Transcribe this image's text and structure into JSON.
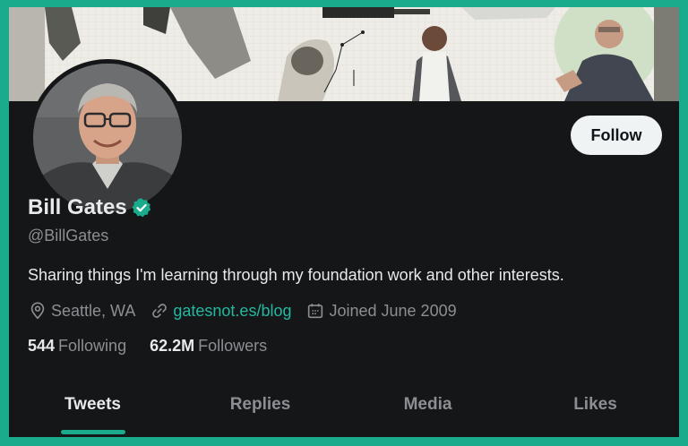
{
  "profile": {
    "name": "Bill Gates",
    "handle": "@BillGates",
    "bio": "Sharing things I'm learning through my foundation work and other interests.",
    "location": "Seattle, WA",
    "website": "gatesnot.es/blog",
    "joined": "Joined June 2009",
    "following_count": "544",
    "following_label": "Following",
    "followers_count": "62.2M",
    "followers_label": "Followers"
  },
  "actions": {
    "follow_label": "Follow"
  },
  "tabs": [
    {
      "label": "Tweets",
      "active": true
    },
    {
      "label": "Replies",
      "active": false
    },
    {
      "label": "Media",
      "active": false
    },
    {
      "label": "Likes",
      "active": false
    }
  ],
  "icons": {
    "verified": "verified-badge-icon",
    "location": "location-pin-icon",
    "link": "link-icon",
    "calendar": "calendar-icon"
  },
  "colors": {
    "accent": "#1aaa8c",
    "background": "#151617",
    "text_primary": "#e7e9ea",
    "text_secondary": "#8b8f93",
    "link": "#25b8a0"
  }
}
